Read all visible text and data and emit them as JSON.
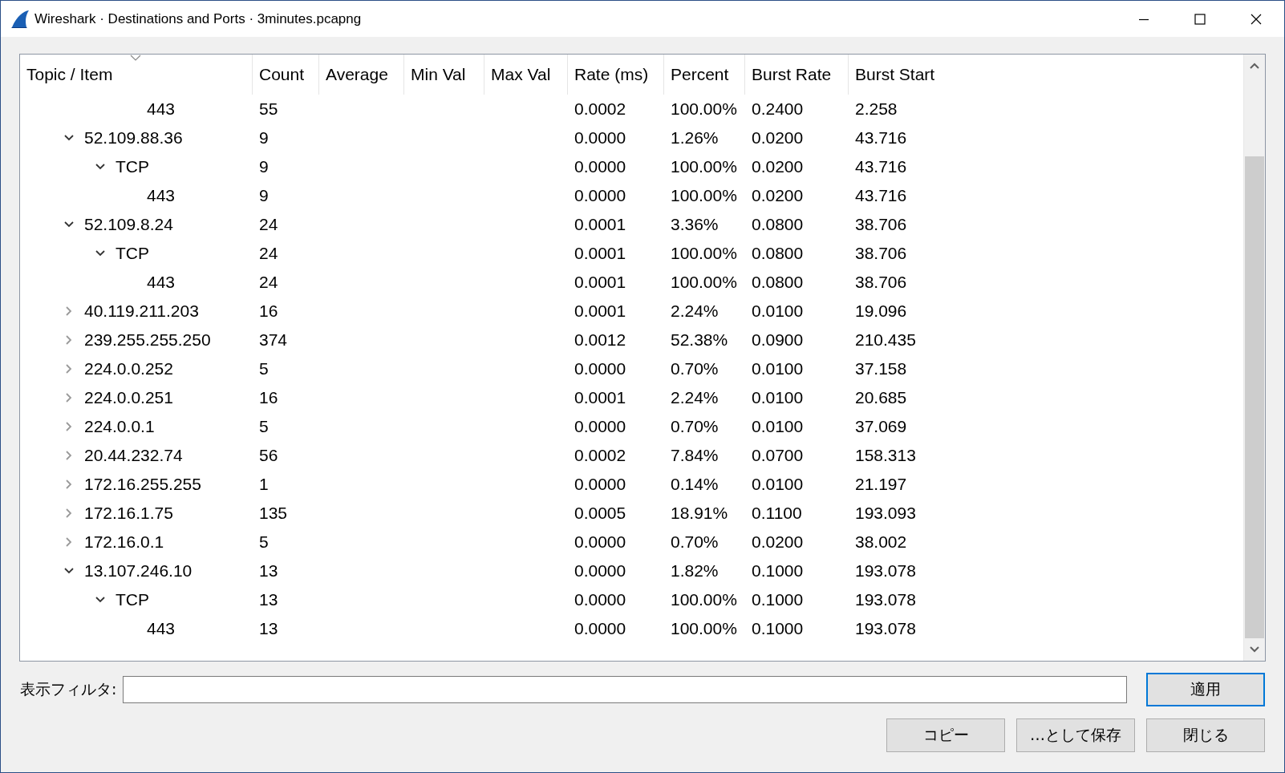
{
  "window": {
    "title": "Wireshark · Destinations and Ports · 3minutes.pcapng"
  },
  "table": {
    "columns": [
      {
        "label": "Topic / Item",
        "sorted": true
      },
      {
        "label": "Count",
        "sorted": false
      },
      {
        "label": "Average",
        "sorted": false
      },
      {
        "label": "Min Val",
        "sorted": false
      },
      {
        "label": "Max Val",
        "sorted": false
      },
      {
        "label": "Rate (ms)",
        "sorted": false
      },
      {
        "label": "Percent",
        "sorted": false
      },
      {
        "label": "Burst Rate",
        "sorted": false
      },
      {
        "label": "Burst Start",
        "sorted": false
      }
    ],
    "rows": [
      {
        "kind": "port",
        "label": "443",
        "count": "55",
        "rate": "0.0002",
        "percent": "100.00%",
        "burst_rate": "0.2400",
        "burst_start": "2.258"
      },
      {
        "kind": "address",
        "label": "52.109.88.36",
        "count": "9",
        "rate": "0.0000",
        "percent": "1.26%",
        "burst_rate": "0.0200",
        "burst_start": "43.716",
        "expanded": true,
        "children": [
          {
            "kind": "protocol",
            "label": "TCP",
            "count": "9",
            "rate": "0.0000",
            "percent": "100.00%",
            "burst_rate": "0.0200",
            "burst_start": "43.716",
            "expanded": true,
            "children": [
              {
                "kind": "port",
                "label": "443",
                "count": "9",
                "rate": "0.0000",
                "percent": "100.00%",
                "burst_rate": "0.0200",
                "burst_start": "43.716"
              }
            ]
          }
        ]
      },
      {
        "kind": "address",
        "label": "52.109.8.24",
        "count": "24",
        "rate": "0.0001",
        "percent": "3.36%",
        "burst_rate": "0.0800",
        "burst_start": "38.706",
        "expanded": true,
        "children": [
          {
            "kind": "protocol",
            "label": "TCP",
            "count": "24",
            "rate": "0.0001",
            "percent": "100.00%",
            "burst_rate": "0.0800",
            "burst_start": "38.706",
            "expanded": true,
            "children": [
              {
                "kind": "port",
                "label": "443",
                "count": "24",
                "rate": "0.0001",
                "percent": "100.00%",
                "burst_rate": "0.0800",
                "burst_start": "38.706"
              }
            ]
          }
        ]
      },
      {
        "kind": "address",
        "label": "40.119.211.203",
        "count": "16",
        "rate": "0.0001",
        "percent": "2.24%",
        "burst_rate": "0.0100",
        "burst_start": "19.096",
        "expanded": false
      },
      {
        "kind": "address",
        "label": "239.255.255.250",
        "count": "374",
        "rate": "0.0012",
        "percent": "52.38%",
        "burst_rate": "0.0900",
        "burst_start": "210.435",
        "expanded": false
      },
      {
        "kind": "address",
        "label": "224.0.0.252",
        "count": "5",
        "rate": "0.0000",
        "percent": "0.70%",
        "burst_rate": "0.0100",
        "burst_start": "37.158",
        "expanded": false
      },
      {
        "kind": "address",
        "label": "224.0.0.251",
        "count": "16",
        "rate": "0.0001",
        "percent": "2.24%",
        "burst_rate": "0.0100",
        "burst_start": "20.685",
        "expanded": false
      },
      {
        "kind": "address",
        "label": "224.0.0.1",
        "count": "5",
        "rate": "0.0000",
        "percent": "0.70%",
        "burst_rate": "0.0100",
        "burst_start": "37.069",
        "expanded": false
      },
      {
        "kind": "address",
        "label": "20.44.232.74",
        "count": "56",
        "rate": "0.0002",
        "percent": "7.84%",
        "burst_rate": "0.0700",
        "burst_start": "158.313",
        "expanded": false
      },
      {
        "kind": "address",
        "label": "172.16.255.255",
        "count": "1",
        "rate": "0.0000",
        "percent": "0.14%",
        "burst_rate": "0.0100",
        "burst_start": "21.197",
        "expanded": false
      },
      {
        "kind": "address",
        "label": "172.16.1.75",
        "count": "135",
        "rate": "0.0005",
        "percent": "18.91%",
        "burst_rate": "0.1100",
        "burst_start": "193.093",
        "expanded": false
      },
      {
        "kind": "address",
        "label": "172.16.0.1",
        "count": "5",
        "rate": "0.0000",
        "percent": "0.70%",
        "burst_rate": "0.0200",
        "burst_start": "38.002",
        "expanded": false
      },
      {
        "kind": "address",
        "label": "13.107.246.10",
        "count": "13",
        "rate": "0.0000",
        "percent": "1.82%",
        "burst_rate": "0.1000",
        "burst_start": "193.078",
        "expanded": true,
        "children": [
          {
            "kind": "protocol",
            "label": "TCP",
            "count": "13",
            "rate": "0.0000",
            "percent": "100.00%",
            "burst_rate": "0.1000",
            "burst_start": "193.078",
            "expanded": true,
            "children": [
              {
                "kind": "port",
                "label": "443",
                "count": "13",
                "rate": "0.0000",
                "percent": "100.00%",
                "burst_rate": "0.1000",
                "burst_start": "193.078"
              }
            ]
          }
        ]
      }
    ]
  },
  "filter": {
    "label": "表示フィルタ:"
  },
  "apply_button": {
    "label": "適用",
    "focused": true
  },
  "buttons": [
    "コピー",
    "…として保存",
    "閉じる"
  ]
}
